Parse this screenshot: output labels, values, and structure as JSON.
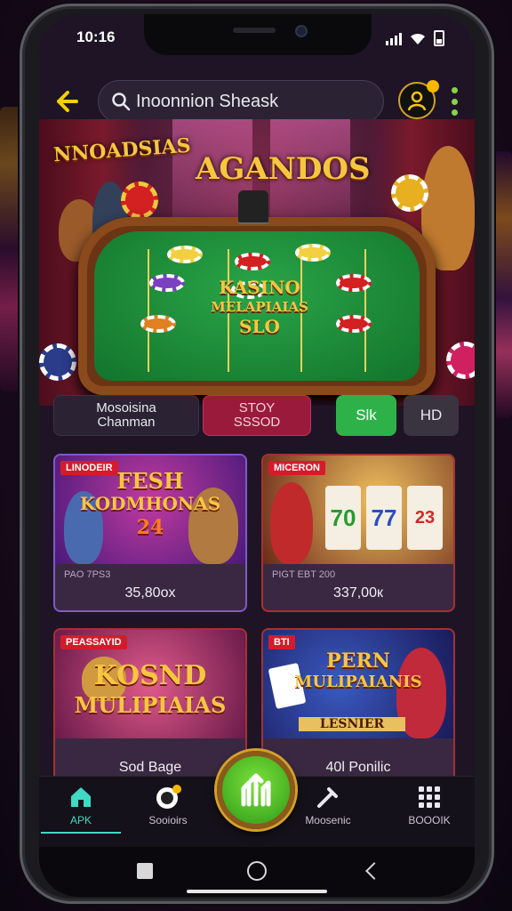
{
  "status_bar": {
    "time": "10:16"
  },
  "search": {
    "placeholder": "Inoonnion Sheask"
  },
  "hero": {
    "title_left": "NNOADSIAS",
    "title_right": "AGANDOS",
    "table_logo_line1": "KASINO",
    "table_logo_line2": "MELAPIAIAS",
    "table_logo_line3": "SLO"
  },
  "filters": {
    "tab1_line1": "Mosoisina",
    "tab1_line2": "Chanman",
    "tab2_line1": "STOY",
    "tab2_line2": "SSSOD",
    "tab3": "Slk",
    "tab4": "HD"
  },
  "cards": [
    {
      "tag": "LINODEIR",
      "title_line1": "FESH",
      "title_line2": "KODMHONAS",
      "badge": "24",
      "subtitle": "PAO 7PS3",
      "price": "35,80ox"
    },
    {
      "tag": "MICERON",
      "title_line1": "70",
      "title_line2": "77",
      "badge": "23",
      "subtitle": "PIGT EBT 200",
      "price": "337,00к"
    },
    {
      "tag": "PEASSAYID",
      "title_line1": "KOSND",
      "title_line2": "MULIPIAIAS",
      "subtitle": "",
      "price": "Sod Bage"
    },
    {
      "tag": "BTI",
      "title_line1": "PERN",
      "title_line2": "MULIPAIANIS",
      "badge": "LESNIER",
      "subtitle": "",
      "price": "40l Ponilic"
    }
  ],
  "bottom_nav": {
    "item1": "APK",
    "item2": "Sooioirs",
    "item4": "Moosenic",
    "item5": "BOOOIK"
  },
  "colors": {
    "accent_yellow": "#f5d000",
    "active_teal": "#40d9c4",
    "green": "#2fb14a",
    "crimson": "#9a1a3c"
  },
  "icons": {
    "back": "arrow-left-icon",
    "search": "search-icon",
    "user": "user-gold-icon",
    "more": "more-vertical-icon",
    "home": "home-icon",
    "chips": "poker-chip-icon",
    "center": "play-icon",
    "tools": "tools-icon",
    "grid": "grid-icon"
  }
}
